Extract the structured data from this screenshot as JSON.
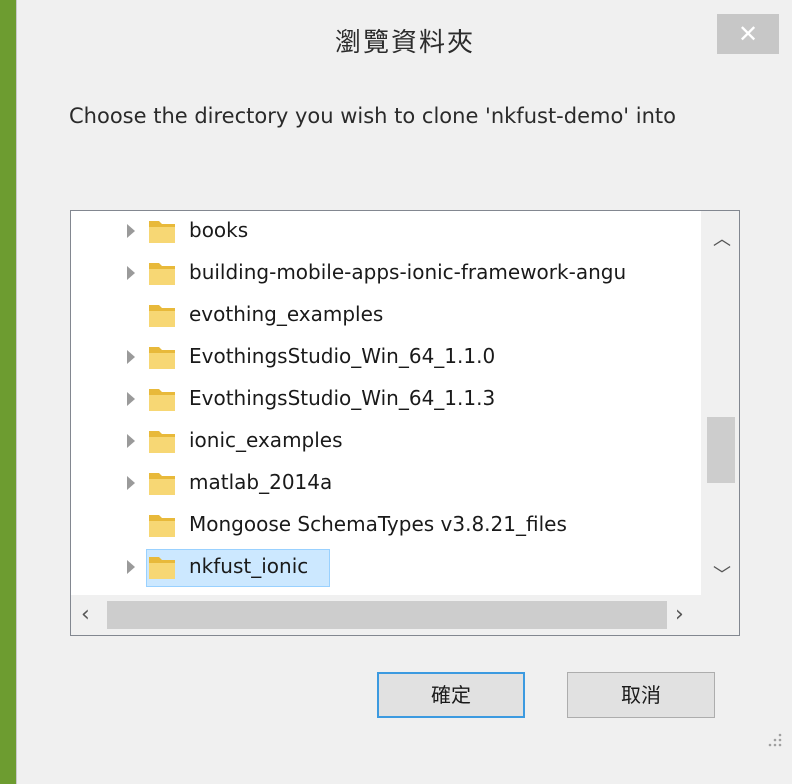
{
  "dialog": {
    "title": "瀏覽資料夾",
    "close_icon": "close-icon",
    "prompt": "Choose the directory you wish to clone 'nkfust-demo' into"
  },
  "tree": {
    "items": [
      {
        "label": "books",
        "expandable": true,
        "selected": false
      },
      {
        "label": "building-mobile-apps-ionic-framework-angu",
        "expandable": true,
        "selected": false
      },
      {
        "label": "evothing_examples",
        "expandable": false,
        "selected": false
      },
      {
        "label": "EvothingsStudio_Win_64_1.1.0",
        "expandable": true,
        "selected": false
      },
      {
        "label": "EvothingsStudio_Win_64_1.1.3",
        "expandable": true,
        "selected": false
      },
      {
        "label": "ionic_examples",
        "expandable": true,
        "selected": false
      },
      {
        "label": "matlab_2014a",
        "expandable": true,
        "selected": false
      },
      {
        "label": "Mongoose SchemaTypes v3.8.21_files",
        "expandable": false,
        "selected": false
      },
      {
        "label": "nkfust_ionic",
        "expandable": true,
        "selected": true
      }
    ]
  },
  "buttons": {
    "ok_label": "確定",
    "cancel_label": "取消"
  },
  "colors": {
    "background": "#8dc63f",
    "selection_fill": "#cce8ff",
    "selection_border": "#99d1ff",
    "default_button_border": "#3c9ae0"
  }
}
